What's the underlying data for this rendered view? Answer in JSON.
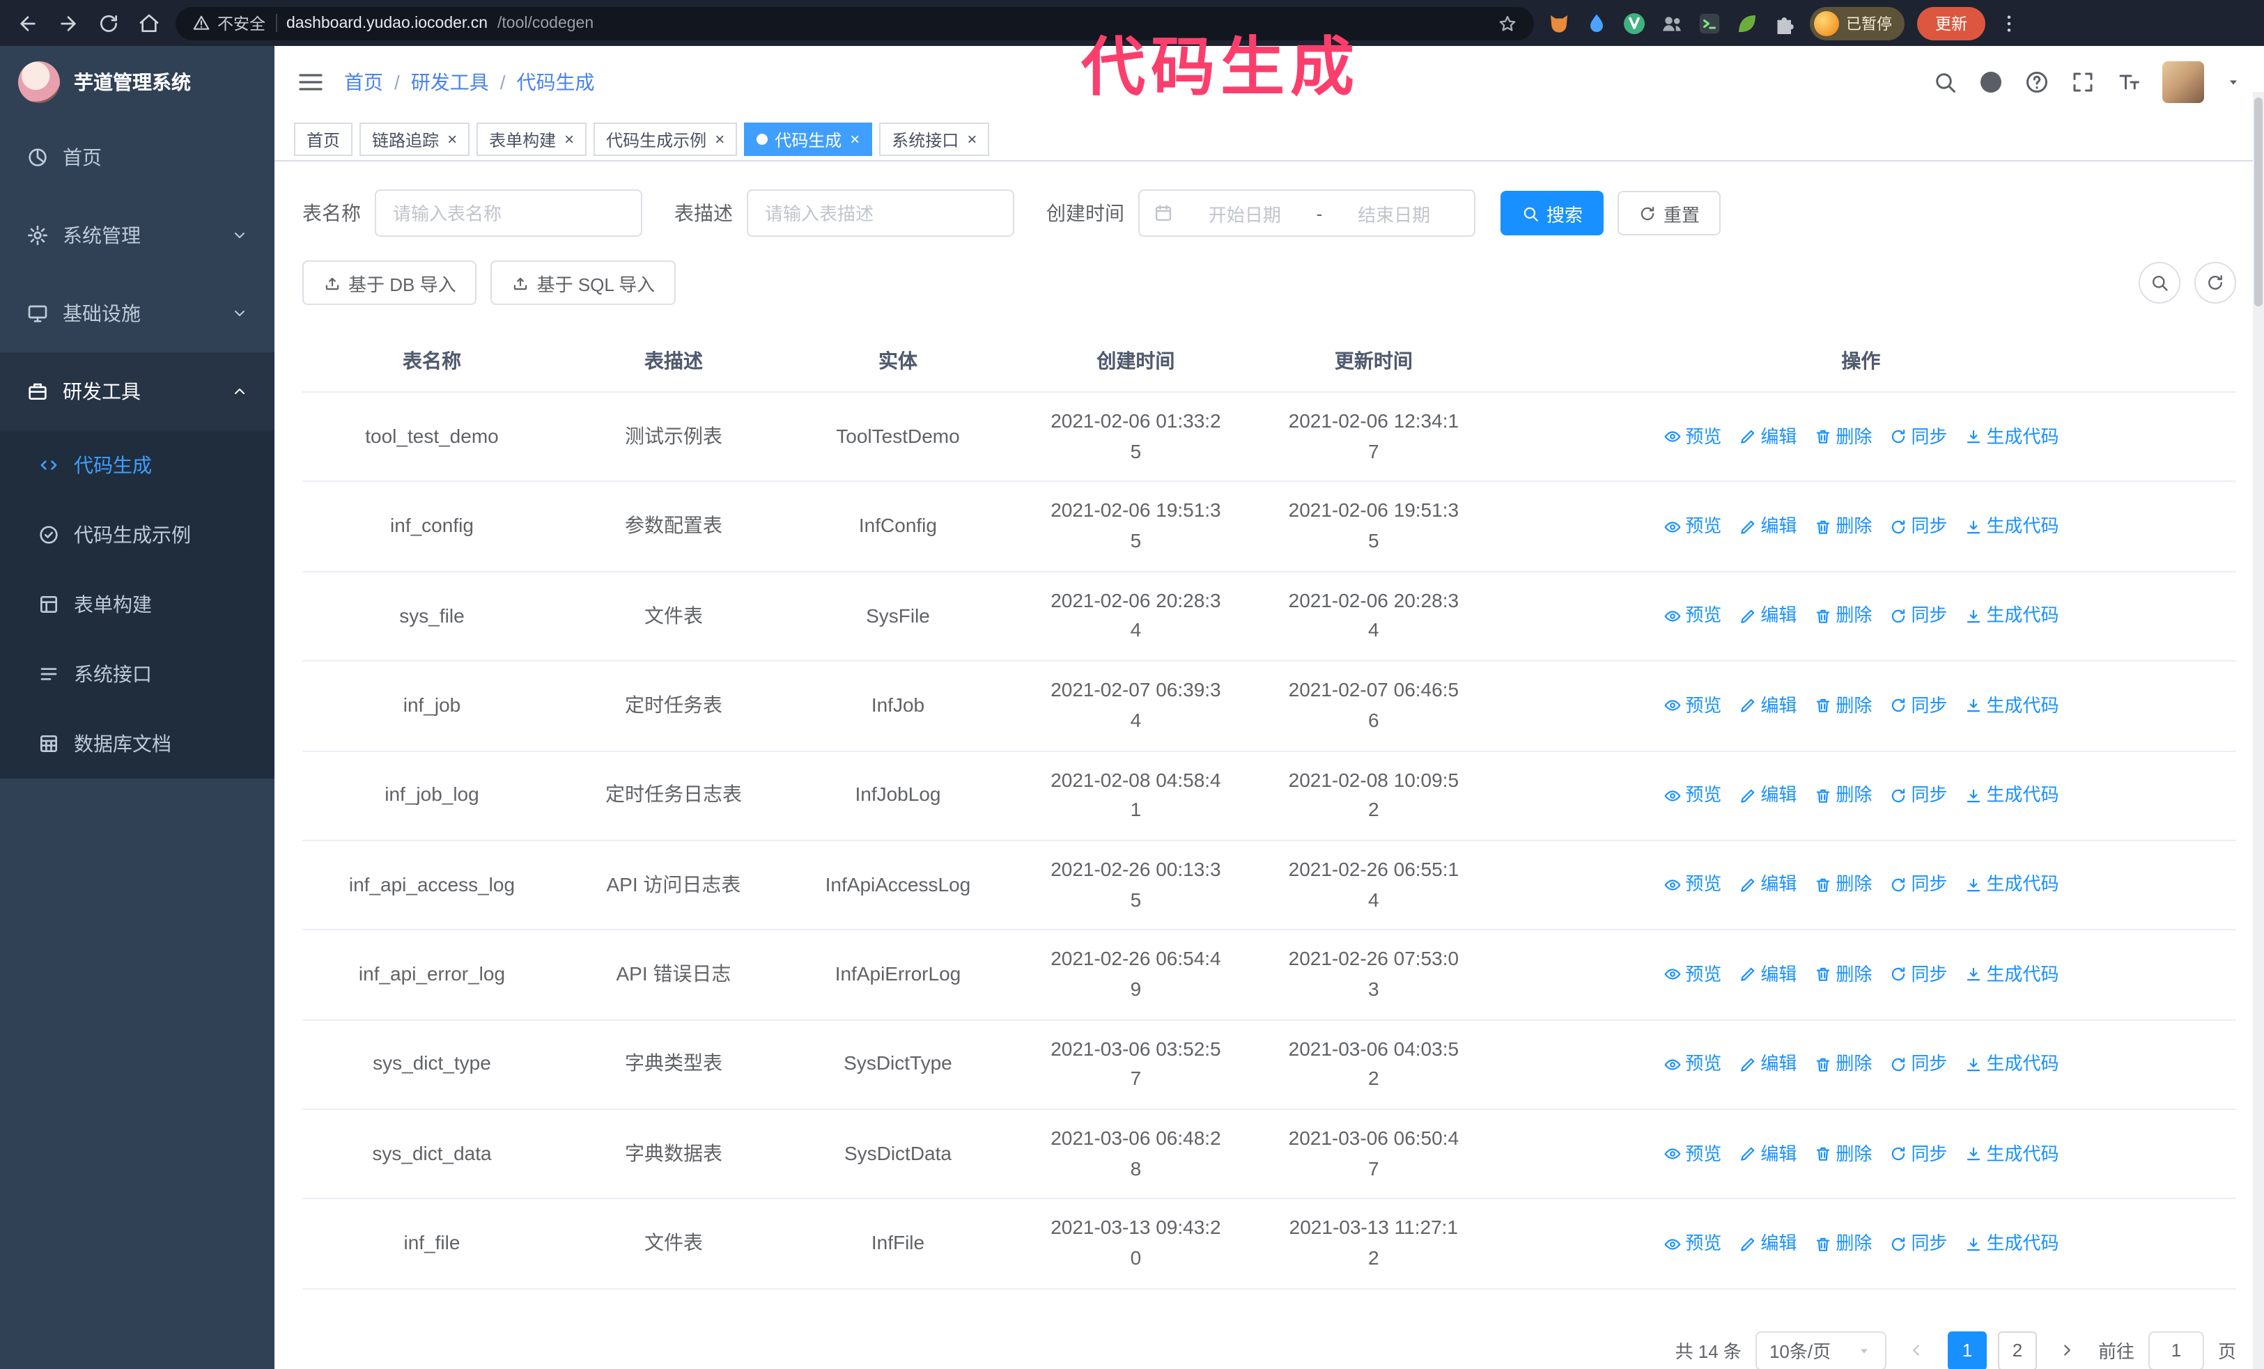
{
  "colors": {
    "primary": "#1890ff",
    "sidebar_bg": "#304156",
    "submenu_bg": "#1f2d3d",
    "active_menu_text": "#409eff",
    "annotation": "#fb3e6c",
    "update_button_bg": "#dd5740",
    "active_tab_bg": "#409eff"
  },
  "browser": {
    "security_label": "不安全",
    "url_host": "dashboard.yudao.iocoder.cn",
    "url_path": "/tool/codegen",
    "paused_badge": "已暂停",
    "update_button": "更新",
    "extensions": [
      {
        "key": "fox",
        "color": "#e98a3c"
      },
      {
        "key": "drop",
        "color": "#4aa3ff"
      },
      {
        "key": "v-circle",
        "color": "#3fb27f"
      },
      {
        "key": "people",
        "color": "#a8adb4"
      },
      {
        "key": "dark-tool",
        "color": "#3a4048"
      },
      {
        "key": "leaf",
        "color": "#6cae3e"
      },
      {
        "key": "puzzle",
        "color": "#c3c7cd"
      }
    ]
  },
  "annotation": {
    "text": "代码生成"
  },
  "sidebar": {
    "logo_title": "芋道管理系统",
    "items": [
      {
        "key": "home",
        "label": "首页",
        "icon": "dashboard",
        "type": "item"
      },
      {
        "key": "system",
        "label": "系统管理",
        "icon": "gear",
        "type": "group",
        "state": "collapsed"
      },
      {
        "key": "infra",
        "label": "基础设施",
        "icon": "infra",
        "type": "group",
        "state": "collapsed"
      },
      {
        "key": "devtools",
        "label": "研发工具",
        "icon": "tools",
        "type": "group",
        "state": "expanded"
      }
    ],
    "submenu": [
      {
        "key": "codegen",
        "label": "代码生成",
        "icon": "code",
        "active": true
      },
      {
        "key": "codegen-example",
        "label": "代码生成示例",
        "icon": "example",
        "active": false
      },
      {
        "key": "form-builder",
        "label": "表单构建",
        "icon": "form",
        "active": false
      },
      {
        "key": "system-api",
        "label": "系统接口",
        "icon": "api",
        "active": false
      },
      {
        "key": "db-doc",
        "label": "数据库文档",
        "icon": "dbdoc",
        "active": false
      }
    ]
  },
  "header": {
    "breadcrumb": [
      "首页",
      "研发工具",
      "代码生成"
    ]
  },
  "tabs": [
    {
      "label": "首页",
      "closable": false,
      "active": false
    },
    {
      "label": "链路追踪",
      "closable": true,
      "active": false
    },
    {
      "label": "表单构建",
      "closable": true,
      "active": false
    },
    {
      "label": "代码生成示例",
      "closable": true,
      "active": false
    },
    {
      "label": "代码生成",
      "closable": true,
      "active": true
    },
    {
      "label": "系统接口",
      "closable": true,
      "active": false
    }
  ],
  "filters": {
    "table_name_label": "表名称",
    "table_name_placeholder": "请输入表名称",
    "table_desc_label": "表描述",
    "table_desc_placeholder": "请输入表描述",
    "create_time_label": "创建时间",
    "date_start_placeholder": "开始日期",
    "date_separator": "-",
    "date_end_placeholder": "结束日期",
    "search_button": "搜索",
    "reset_button": "重置"
  },
  "toolbar": {
    "import_db_label": "基于 DB 导入",
    "import_sql_label": "基于 SQL 导入"
  },
  "table": {
    "columns": [
      "表名称",
      "表描述",
      "实体",
      "创建时间",
      "更新时间",
      "操作"
    ],
    "actions": [
      {
        "key": "preview",
        "label": "预览",
        "icon": "eye"
      },
      {
        "key": "edit",
        "label": "编辑",
        "icon": "pencil"
      },
      {
        "key": "delete",
        "label": "删除",
        "icon": "trash"
      },
      {
        "key": "sync",
        "label": "同步",
        "icon": "refresh"
      },
      {
        "key": "generate",
        "label": "生成代码",
        "icon": "download"
      }
    ],
    "rows": [
      {
        "name": "tool_test_demo",
        "desc": "测试示例表",
        "entity": "ToolTestDemo",
        "created": "2021-02-06 01:33:25",
        "updated": "2021-02-06 12:34:17"
      },
      {
        "name": "inf_config",
        "desc": "参数配置表",
        "entity": "InfConfig",
        "created": "2021-02-06 19:51:35",
        "updated": "2021-02-06 19:51:35"
      },
      {
        "name": "sys_file",
        "desc": "文件表",
        "entity": "SysFile",
        "created": "2021-02-06 20:28:34",
        "updated": "2021-02-06 20:28:34"
      },
      {
        "name": "inf_job",
        "desc": "定时任务表",
        "entity": "InfJob",
        "created": "2021-02-07 06:39:34",
        "updated": "2021-02-07 06:46:56"
      },
      {
        "name": "inf_job_log",
        "desc": "定时任务日志表",
        "entity": "InfJobLog",
        "created": "2021-02-08 04:58:41",
        "updated": "2021-02-08 10:09:52"
      },
      {
        "name": "inf_api_access_log",
        "desc": "API 访问日志表",
        "entity": "InfApiAccessLog",
        "created": "2021-02-26 00:13:35",
        "updated": "2021-02-26 06:55:14"
      },
      {
        "name": "inf_api_error_log",
        "desc": "API 错误日志",
        "entity": "InfApiErrorLog",
        "created": "2021-02-26 06:54:49",
        "updated": "2021-02-26 07:53:03"
      },
      {
        "name": "sys_dict_type",
        "desc": "字典类型表",
        "entity": "SysDictType",
        "created": "2021-03-06 03:52:57",
        "updated": "2021-03-06 04:03:52"
      },
      {
        "name": "sys_dict_data",
        "desc": "字典数据表",
        "entity": "SysDictData",
        "created": "2021-03-06 06:48:28",
        "updated": "2021-03-06 06:50:47"
      },
      {
        "name": "inf_file",
        "desc": "文件表",
        "entity": "InfFile",
        "created": "2021-03-13 09:43:20",
        "updated": "2021-03-13 11:27:12"
      }
    ]
  },
  "pagination": {
    "total_text": "共 14 条",
    "page_size": "10条/页",
    "pages": [
      "1",
      "2"
    ],
    "active_page": "1",
    "goto_prefix": "前往",
    "goto_value": "1",
    "goto_suffix": "页"
  }
}
